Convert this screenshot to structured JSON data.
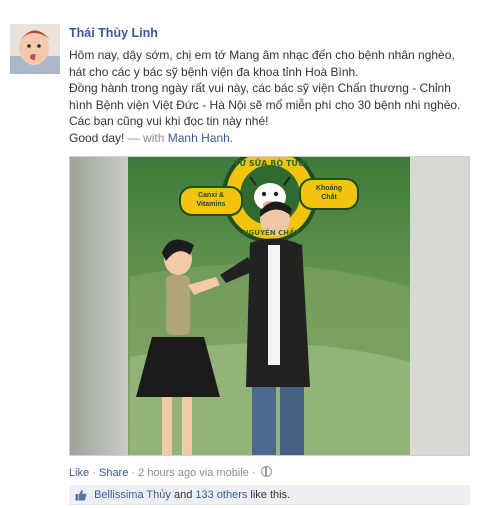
{
  "post": {
    "author": "Thái Thùy Linh",
    "text_lines": [
      "Hôm nay, dậy sớm, chị em tớ Mang âm nhạc đến cho bệnh nhân nghèo,",
      "hát cho các y bác sỹ bệnh viện đa khoa tỉnh Hoà Bình.",
      "Đồng hành trong ngày rất vui này, các bác sỹ viện Chấn thương - Chỉnh",
      "hình Bệnh viện Việt Đức - Hà Nội sẽ mổ miễn phí cho 30 bệnh nhi nghèo.",
      "Các bạn cũng vui khi đọc tin này nhé!"
    ],
    "closing": "Good day!",
    "with_prefix": "— with",
    "with_person": "Manh Hanh."
  },
  "photo": {
    "banner_words": [
      "TỪ SỮA BÒ TƯƠI",
      "NGUYÊN CHẤT"
    ],
    "left_sign": [
      "Canxi &",
      "Vitamins"
    ],
    "right_sign": [
      "Khoáng",
      "Chất"
    ]
  },
  "meta": {
    "like": "Like",
    "dot1": "·",
    "share": "Share",
    "dot2": "·",
    "time": "2 hours ago via mobile",
    "dot3": "·"
  },
  "likes": {
    "person": "Bellissima Thủy",
    "and": "and",
    "others": "133 others",
    "suffix": "like this."
  },
  "colors": {
    "link": "#3b5998",
    "likes_bg": "#edeff4",
    "banner_green": "#2f6a2f",
    "banner_yellow": "#f1c40f"
  }
}
